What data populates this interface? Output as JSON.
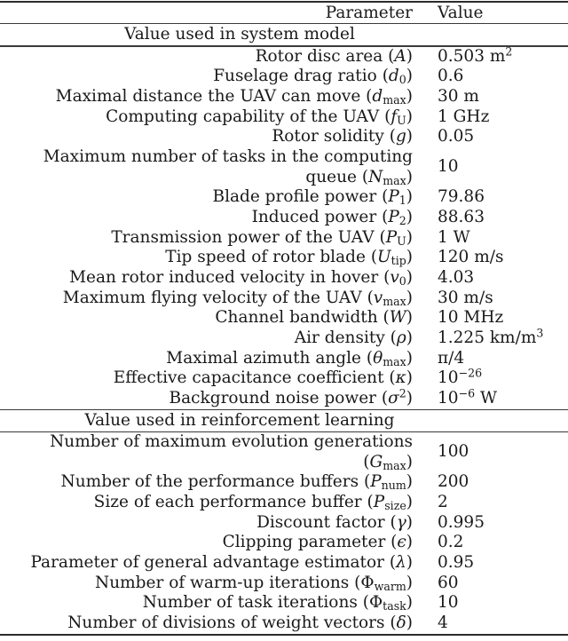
{
  "table": {
    "header": {
      "parameter": "Parameter",
      "value": "Value"
    },
    "sections": [
      {
        "title": "Value used in system model",
        "rows": [
          {
            "label": "Rotor disc area",
            "symbol": "A",
            "sub": "",
            "sup": "",
            "value": "0.503 m",
            "value_sup": "2"
          },
          {
            "label": "Fuselage drag ratio",
            "symbol": "d",
            "sub": "0",
            "sup": "",
            "value": "0.6",
            "value_sup": ""
          },
          {
            "label": "Maximal distance the UAV can move",
            "symbol": "d",
            "sub": "max",
            "sup": "",
            "value": "30 m",
            "value_sup": ""
          },
          {
            "label": "Computing capability of the UAV",
            "symbol": "f",
            "sub": "U",
            "sup": "",
            "value": "1 GHz",
            "value_sup": ""
          },
          {
            "label": "Rotor solidity",
            "symbol": "g",
            "sub": "",
            "sup": "",
            "value": "0.05",
            "value_sup": ""
          },
          {
            "label_line1": "Maximum number of tasks in the computing",
            "label": "queue",
            "symbol": "N",
            "sub": "max",
            "sup": "",
            "value": "10",
            "value_sup": "",
            "multiline": true
          },
          {
            "label": "Blade profile power",
            "symbol": "P",
            "sub": "1",
            "sup": "",
            "value": "79.86",
            "value_sup": ""
          },
          {
            "label": "Induced power",
            "symbol": "P",
            "sub": "2",
            "sup": "",
            "value": "88.63",
            "value_sup": ""
          },
          {
            "label": "Transmission power of the UAV",
            "symbol": "P",
            "sub": "U",
            "sup": "",
            "value": "1 W",
            "value_sup": ""
          },
          {
            "label": "Tip speed of rotor blade",
            "symbol": "U",
            "sub": "tip",
            "sup": "",
            "value": "120 m/s",
            "value_sup": ""
          },
          {
            "label": "Mean rotor induced velocity in hover",
            "symbol": "v",
            "sub": "0",
            "sup": "",
            "value": "4.03",
            "value_sup": ""
          },
          {
            "label": "Maximum flying velocity of the UAV",
            "symbol": "v",
            "sub": "max",
            "sup": "",
            "value": "30 m/s",
            "value_sup": ""
          },
          {
            "label": "Channel bandwidth",
            "symbol": "W",
            "sub": "",
            "sup": "",
            "value": "10 MHz",
            "value_sup": ""
          },
          {
            "label": "Air density",
            "symbol": "ρ",
            "sub": "",
            "sup": "",
            "value": "1.225 km/m",
            "value_sup": "3"
          },
          {
            "label": "Maximal azimuth angle",
            "symbol": "θ",
            "sub": "max",
            "sup": "",
            "value": "π/4",
            "value_sup": ""
          },
          {
            "label": "Effective capacitance coefficient",
            "symbol": "κ",
            "sub": "",
            "sup": "",
            "value": "10",
            "value_sup": "−26"
          },
          {
            "label": "Background noise power",
            "symbol": "σ",
            "sub": "",
            "sup": "2",
            "value": "10",
            "value_sup": "−6",
            "value_suffix": " W"
          }
        ]
      },
      {
        "title": "Value used in reinforcement learning",
        "rows": [
          {
            "label_line1": "Number of maximum evolution generations",
            "label": "",
            "symbol": "G",
            "sub": "max",
            "sup": "",
            "value": "100",
            "value_sup": "",
            "multiline": true
          },
          {
            "label": "Number of the performance buffers",
            "symbol": "P",
            "sub": "num",
            "sup": "",
            "value": "200",
            "value_sup": ""
          },
          {
            "label": "Size of each performance buffer",
            "symbol": "P",
            "sub": "size",
            "sup": "",
            "value": "2",
            "value_sup": ""
          },
          {
            "label": "Discount factor",
            "symbol": "γ",
            "sub": "",
            "sup": "",
            "value": "0.995",
            "value_sup": ""
          },
          {
            "label": "Clipping parameter",
            "symbol": "ϵ",
            "sub": "",
            "sup": "",
            "value": "0.2",
            "value_sup": ""
          },
          {
            "label": "Parameter of general advantage estimator",
            "symbol": "λ",
            "sub": "",
            "sup": "",
            "value": "0.95",
            "value_sup": ""
          },
          {
            "label": "Number of warm-up iterations",
            "symbol": "Φ",
            "sub": "warm",
            "sup": "",
            "value": "60",
            "value_sup": "",
            "upright_symbol": true
          },
          {
            "label": "Number of task iterations",
            "symbol": "Φ",
            "sub": "task",
            "sup": "",
            "value": "10",
            "value_sup": "",
            "upright_symbol": true
          },
          {
            "label": "Number of divisions of weight vectors",
            "symbol": "δ",
            "sub": "",
            "sup": "",
            "value": "4",
            "value_sup": ""
          }
        ]
      }
    ]
  }
}
